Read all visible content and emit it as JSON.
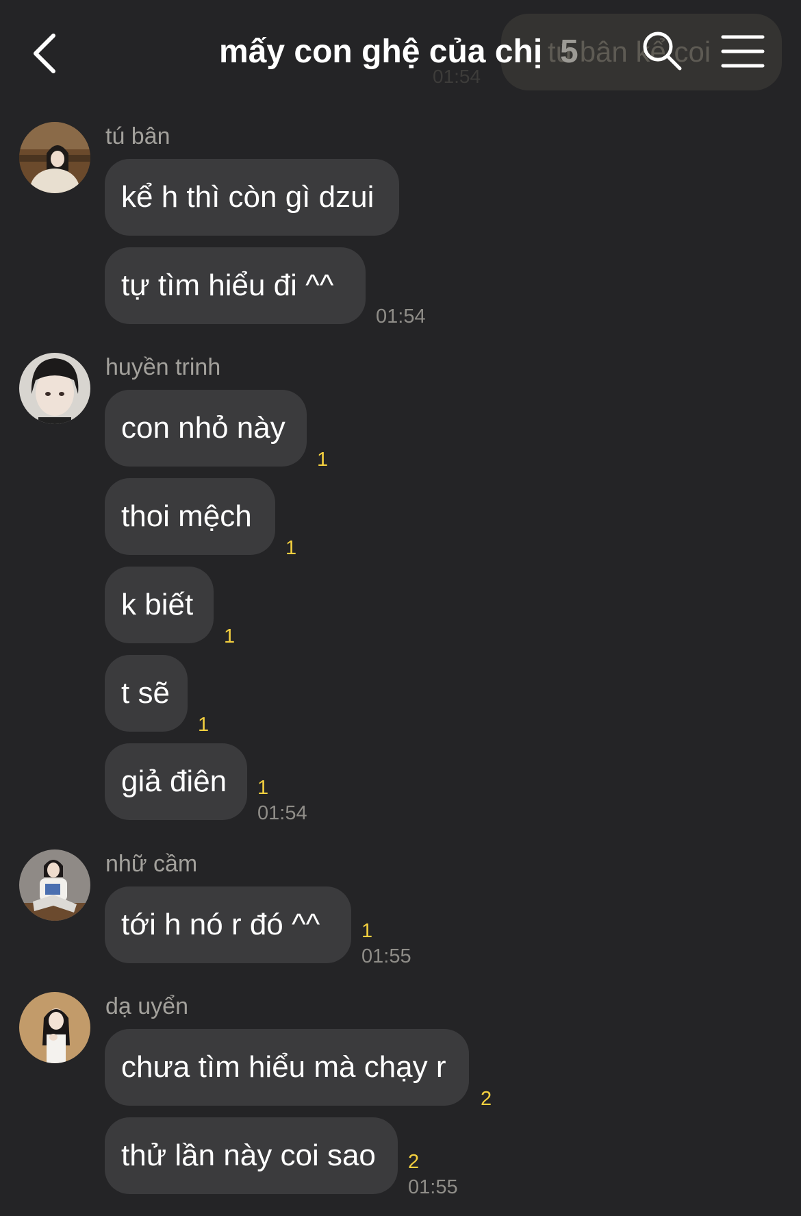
{
  "background_color": "#242426",
  "accent_unread_color": "#f4d03f",
  "header": {
    "title": "mấy con ghệ của chị",
    "member_count": "5",
    "back_icon": "chevron-left-icon",
    "search_icon": "search-icon",
    "menu_icon": "hamburger-menu-icon"
  },
  "previous_message": {
    "text": "tú bân kể coi",
    "time": "01:54"
  },
  "groups": [
    {
      "sender": "tú bân",
      "messages": [
        {
          "text": "kể h thì còn gì dzui",
          "unread": ""
        },
        {
          "text": "tự tìm hiểu đi ^^",
          "unread": ""
        }
      ],
      "time": "01:54"
    },
    {
      "sender": "huyền trinh",
      "messages": [
        {
          "text": "con nhỏ này",
          "unread": "1"
        },
        {
          "text": "thoi mệch",
          "unread": "1"
        },
        {
          "text": "k biết",
          "unread": "1"
        },
        {
          "text": "t sẽ",
          "unread": "1"
        },
        {
          "text": "giả điên",
          "unread": "1"
        }
      ],
      "time": "01:54"
    },
    {
      "sender": "nhữ cầm",
      "messages": [
        {
          "text": "tới h nó r đó ^^",
          "unread": "1"
        }
      ],
      "time": "01:55"
    },
    {
      "sender": "dạ uyển",
      "messages": [
        {
          "text": "chưa tìm hiểu mà chạy r",
          "unread": "2"
        },
        {
          "text": "thử lần này coi sao",
          "unread": "2"
        }
      ],
      "time": "01:55"
    }
  ]
}
